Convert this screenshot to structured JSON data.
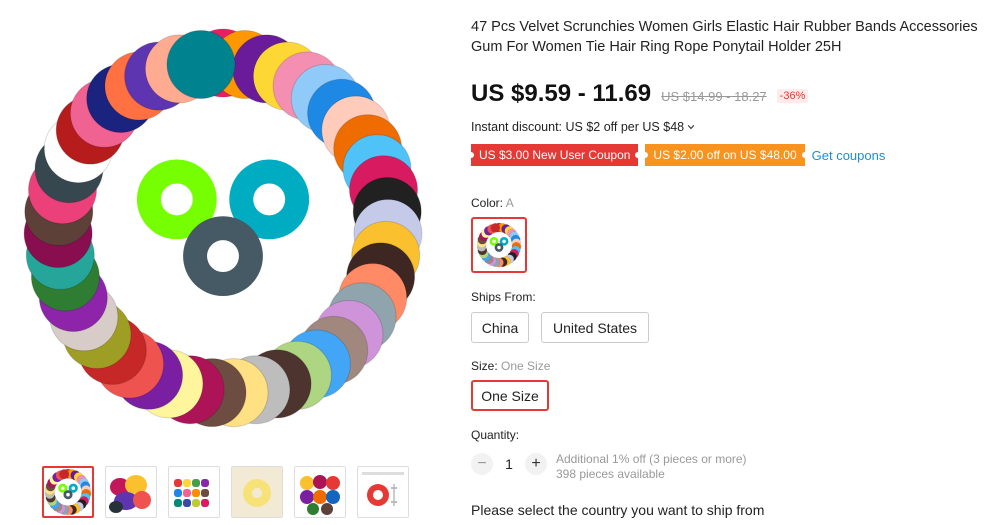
{
  "product": {
    "title": "47 Pcs Velvet Scrunchies Women Girls Elastic Hair Rubber Bands Accessories Gum For Women Tie Hair Ring Rope Ponytail Holder 25H",
    "price_range": "US $9.59 - 11.69",
    "original_price": "US $14.99 - 18.27",
    "discount_percent": "-36%",
    "instant_discount": "Instant discount: US $2 off per US $48"
  },
  "coupons": {
    "new_user": "US $3.00 New User Coupon",
    "threshold": "US $2.00 off on US $48.00",
    "get_coupons_label": "Get coupons"
  },
  "color": {
    "label": "Color:",
    "selected": "A"
  },
  "ships_from": {
    "label": "Ships From:",
    "options": [
      "China",
      "United States"
    ]
  },
  "size": {
    "label": "Size:",
    "selected": "One Size",
    "options": [
      "One Size"
    ]
  },
  "quantity": {
    "label": "Quantity:",
    "value": "1",
    "minus": "−",
    "plus": "+",
    "bulk_note": "Additional 1% off (3 pieces or more)",
    "available": "398 pieces available"
  },
  "ship_note": "Please select the country you want to ship from",
  "icons": {
    "instant_chevron": "chevron-down-icon"
  },
  "colors": {
    "accent_red": "#e53935",
    "coupon_orange": "#f7931e",
    "link_blue": "#1b8fd6"
  },
  "gallery": {
    "thumbnail_count": 6,
    "active_index": 0
  }
}
